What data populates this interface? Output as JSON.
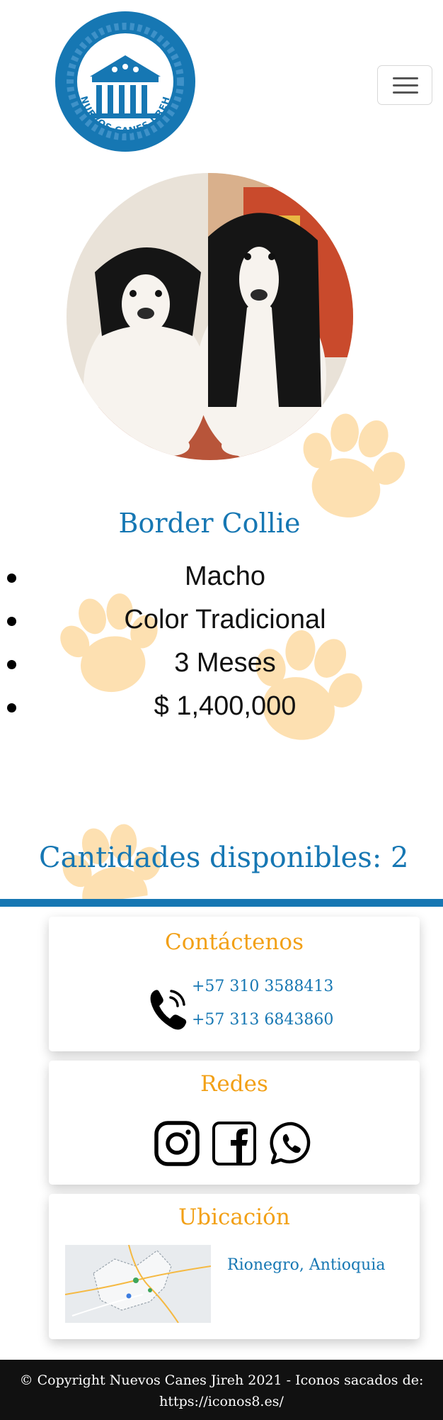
{
  "header": {
    "logo_text": "NUEVOS CANES JIREH",
    "menu_icon": "hamburger-menu-icon"
  },
  "product": {
    "image_icon": "border-collie-puppies-photo",
    "breed": "Border Collie",
    "details": [
      "Macho",
      "Color Tradicional",
      "3 Meses",
      "$ 1,400,000"
    ],
    "availability": "Cantidades disponibles: 2"
  },
  "contact": {
    "title": "Contáctenos",
    "phone_icon": "phone-icon",
    "phones": [
      "+57 310 3588413",
      "+57 313 6843860"
    ]
  },
  "social": {
    "title": "Redes",
    "icons": [
      "instagram-icon",
      "facebook-icon",
      "whatsapp-icon"
    ]
  },
  "location": {
    "title": "Ubicación",
    "map_icon": "map-thumbnail",
    "place": "Rionegro, Antioquia"
  },
  "footer": {
    "line1": "© Copyright Nuevos Canes Jireh 2021 - Iconos sacados de:",
    "line2": "https://iconos8.es/"
  },
  "colors": {
    "brand_blue": "#1677b3",
    "accent_orange": "#f2a016",
    "paw": "#fcc366",
    "footer_bg": "#111111"
  }
}
